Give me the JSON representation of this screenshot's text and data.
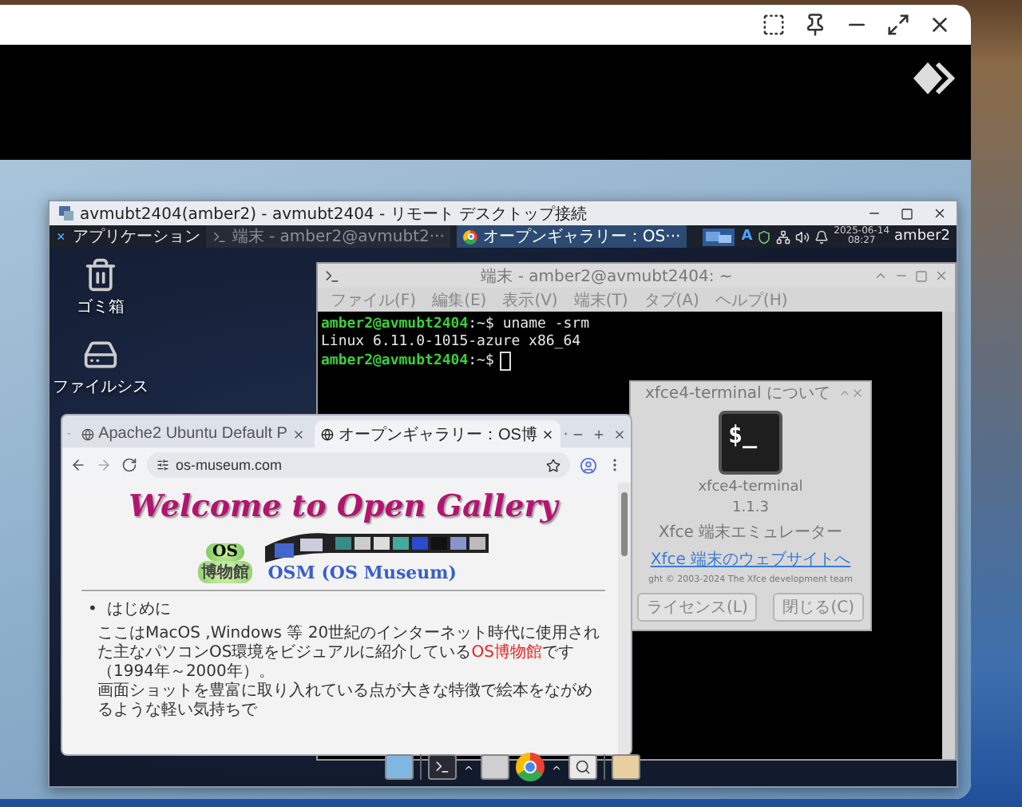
{
  "remote_window": {
    "title": "avmubt2404(amber2) - avmubt2404 - リモート デスクトップ接続"
  },
  "panel": {
    "menu": "アプリケーション",
    "tasks": [
      {
        "label": "端末 - amber2@avmubt2···",
        "kind": "terminal",
        "selected": false
      },
      {
        "label": "オープンギャラリー：OS···",
        "kind": "browser",
        "selected": true
      }
    ],
    "input_indicator": "A",
    "date": "2025-06-14",
    "time": "08:27",
    "user": "amber2"
  },
  "desktop_icons": [
    {
      "label": "ゴミ箱",
      "kind": "trash"
    },
    {
      "label": "ファイルシス",
      "kind": "drive"
    }
  ],
  "terminal": {
    "title": "端末 - amber2@avmubt2404: ~",
    "menu": [
      "ファイル(F)",
      "編集(E)",
      "表示(V)",
      "端末(T)",
      "タブ(A)",
      "ヘルプ(H)"
    ],
    "lines": [
      {
        "kind": "prompt",
        "user_host": "amber2@avmubt2404",
        "path": ":~$",
        "command": "uname -srm",
        "cursor": false
      },
      {
        "kind": "output",
        "text": "Linux 6.11.0-1015-azure x86_64"
      },
      {
        "kind": "prompt",
        "user_host": "amber2@avmubt2404",
        "path": ":~$",
        "cursor": true
      }
    ]
  },
  "about_dialog": {
    "title": "xfce4-terminal について",
    "icon_text": "$_",
    "app_name": "xfce4-terminal",
    "version": "1.1.3",
    "description": "Xfce 端末エミュレーター",
    "link": "Xfce 端末のウェブサイトへ",
    "copyright": "ght © 2003-2024 The Xfce development team",
    "buttons": [
      "ライセンス(L)",
      "閉じる(C)"
    ]
  },
  "browser": {
    "tabs": [
      {
        "title": "Apache2 Ubuntu Default P",
        "selected": false
      },
      {
        "title": "オープンギャラリー：OS博",
        "selected": true
      }
    ],
    "address": "os-museum.com",
    "page": {
      "heading": "Welcome to Open Gallery",
      "logo_top": "OS",
      "logo_bottom": "博物館",
      "site_name": "OSM (OS Museum)",
      "list": [
        {
          "marker": "•",
          "text": "はじめに"
        }
      ],
      "paragraph": {
        "before": "ここはMacOS ,Windows 等 20世紀のインターネット時代に使用された主なパソコンOS環境をビジュアルに紹介している",
        "highlight": "OS博物館",
        "after": "です（1994年～2000年）。"
      },
      "paragraph_2": "画面ショットを豊富に取り入れている点が大きな特徴で絵本をながめるような軽い気持ちで"
    }
  }
}
